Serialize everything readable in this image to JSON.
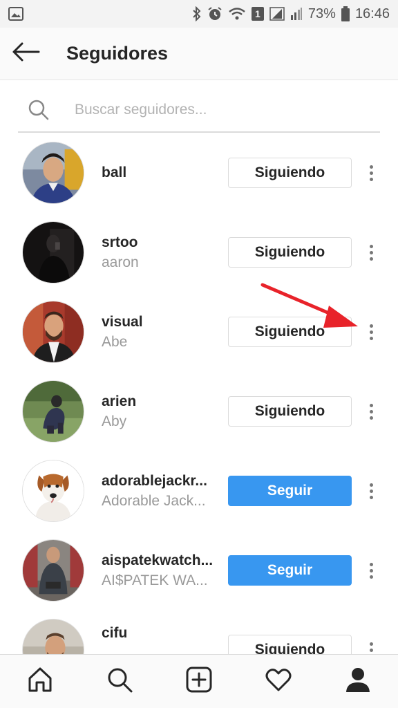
{
  "status_bar": {
    "battery": "73%",
    "time": "16:46",
    "sim_badge": "1"
  },
  "header": {
    "title": "Seguidores"
  },
  "search": {
    "placeholder": "Buscar seguidores..."
  },
  "followers": [
    {
      "username": "ball",
      "fullname": "",
      "button": "Siguiendo"
    },
    {
      "username": "srtoo",
      "fullname": "aaron",
      "button": "Siguiendo"
    },
    {
      "username": "visual",
      "fullname": "Abe",
      "button": "Siguiendo"
    },
    {
      "username": "arien",
      "fullname": "Aby",
      "button": "Siguiendo"
    },
    {
      "username": "adorablejackr...",
      "fullname": "Adorable Jack...",
      "button": "Seguir"
    },
    {
      "username": "aispatekwatch...",
      "fullname": "AI$PATEK WA...",
      "button": "Seguir"
    },
    {
      "username": "cifu",
      "fullname": "",
      "button": "Siguiendo"
    }
  ],
  "colors": {
    "accent_blue": "#3897f0",
    "annotation_arrow": "#e8232a"
  },
  "icons": {
    "nav": [
      "home-icon",
      "search-icon",
      "add-post-icon",
      "heart-icon",
      "profile-icon"
    ]
  }
}
